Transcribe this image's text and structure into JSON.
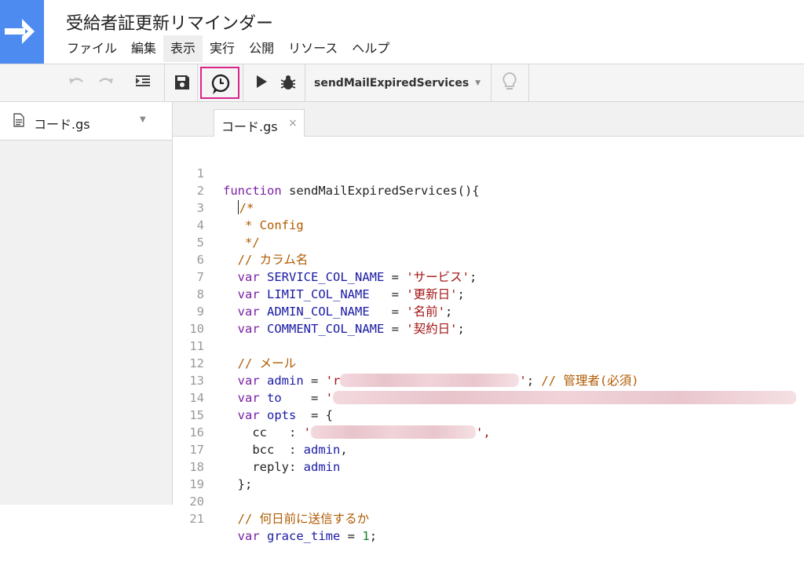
{
  "header": {
    "title": "受給者証更新リマインダー",
    "menu": [
      "ファイル",
      "編集",
      "表示",
      "実行",
      "公開",
      "リソース",
      "ヘルプ"
    ],
    "active_menu": "表示"
  },
  "toolbar": {
    "function_name": "sendMailExpiredServices",
    "buttons": [
      "undo-icon",
      "redo-icon",
      "indent-icon",
      "save-icon",
      "trigger-clock-icon",
      "run-icon",
      "debug-bug-icon",
      "lightbulb-icon"
    ]
  },
  "files": [
    {
      "name": "コード.gs"
    }
  ],
  "editor": {
    "tab_label": "コード.gs",
    "tab_close": "×",
    "line_numbers": [
      "1",
      "2",
      "3",
      "4",
      "5",
      "6",
      "7",
      "8",
      "9",
      "10",
      "11",
      "12",
      "13",
      "14",
      "15",
      "16",
      "17",
      "18",
      "19",
      "20",
      "21"
    ],
    "code": {
      "l1": [
        "function",
        " sendMailExpiredServices(){"
      ],
      "l2": [
        "/*"
      ],
      "l3": [
        "   * Config"
      ],
      "l4": [
        "   */"
      ],
      "l5": [
        "  // カラム名"
      ],
      "l6": [
        "var",
        "SERVICE_COL_NAME",
        " = ",
        "'サービス'",
        ";"
      ],
      "l7": [
        "var",
        "LIMIT_COL_NAME",
        "   = ",
        "'更新日'",
        ";"
      ],
      "l8": [
        "var",
        "ADMIN_COL_NAME",
        "   = ",
        "'名前'",
        ";"
      ],
      "l9": [
        "var",
        "COMMENT_COL_NAME",
        " = ",
        "'契約日'",
        ";"
      ],
      "l11": [
        "  // メール"
      ],
      "l12": [
        "var",
        "admin",
        " = ",
        "'r",
        "'",
        ";",
        " // 管理者(必須)"
      ],
      "l13": [
        "var",
        "to",
        "    = ",
        "'"
      ],
      "l14": [
        "var",
        "opts",
        "  = {"
      ],
      "l15": [
        "    cc   : ",
        "'",
        "',"
      ],
      "l16": [
        "    bcc  : ",
        "admin",
        ","
      ],
      "l17": [
        "    reply: ",
        "admin"
      ],
      "l18": [
        "  };"
      ],
      "l20": [
        "  // 何日前に送信するか"
      ],
      "l21": [
        "var",
        "grace_time",
        " = ",
        "1",
        ";"
      ]
    }
  }
}
